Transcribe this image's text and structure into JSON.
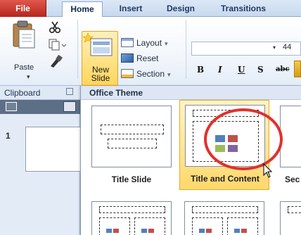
{
  "ribbon_tabs": {
    "file": "File",
    "home": "Home",
    "insert": "Insert",
    "design": "Design",
    "transitions": "Transitions"
  },
  "clipboard": {
    "paste_label": "Paste",
    "group_label": "Clipboard"
  },
  "slides_group": {
    "new_slide_label": "New Slide",
    "layout_label": "Layout",
    "reset_label": "Reset",
    "section_label": "Section"
  },
  "font_group": {
    "font_size": "44"
  },
  "format_buttons": {
    "bold": "B",
    "italic": "I",
    "underline": "U",
    "strike": "S",
    "spacing": "abc"
  },
  "slides_pane": {
    "slide_number": "1"
  },
  "layout_gallery": {
    "header": "Office Theme",
    "items": [
      {
        "name": "Title Slide"
      },
      {
        "name": "Title and Content"
      },
      {
        "name": "Sec"
      }
    ]
  },
  "colors": {
    "accent_selected": "#ffd86b",
    "highlight_circle": "#e0312e",
    "file_tab": "#c53a2f"
  }
}
